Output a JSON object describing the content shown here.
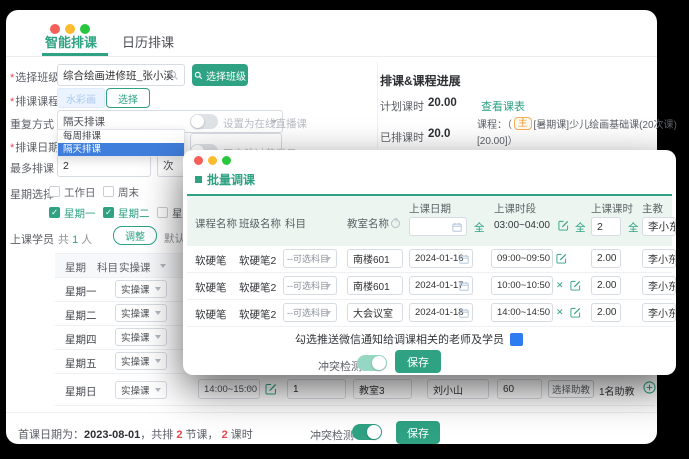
{
  "window": {
    "tabs": [
      {
        "label": "智能排课",
        "active": true
      },
      {
        "label": "日历排课",
        "active": false
      }
    ],
    "form": {
      "class": {
        "label": "选择班级",
        "value": "综合绘画进修班_张小溪",
        "button": "选择班级"
      },
      "course": {
        "label": "排课课程",
        "tag": "水彩画",
        "button": "选择"
      },
      "repeat": {
        "label": "重复方式",
        "value": "隔天排课",
        "options": [
          {
            "label": "每周排课",
            "active": false
          },
          {
            "label": "隔天排课",
            "active": true
          }
        ]
      },
      "date": {
        "label": "排课日期"
      },
      "max": {
        "label": "最多排课",
        "value": "2",
        "unit": "次"
      },
      "weektype": {
        "label": "星期选择",
        "options": [
          {
            "label": "工作日",
            "checked": false
          },
          {
            "label": "周末",
            "checked": false
          }
        ]
      },
      "weekdays": [
        {
          "label": "星期一",
          "checked": true
        },
        {
          "label": "星期二",
          "checked": true
        },
        {
          "label": "星期三",
          "checked": false
        }
      ],
      "students": {
        "label": "上课学员",
        "count_prefix": "共",
        "count": "1",
        "count_suffix": "人",
        "button": "调整",
        "hint": "默认为当前班级"
      },
      "toggles": [
        {
          "label": "设置为在线直播课",
          "on": false
        },
        {
          "label": "开启跳过节假日",
          "on": false
        }
      ]
    },
    "week_table": {
      "header": {
        "day": "星期",
        "subject": "科目",
        "subject_value": "实操课"
      },
      "rows": [
        {
          "day": "星期一",
          "value": "实操课",
          "sunday": false
        },
        {
          "day": "星期二",
          "value": "实操课",
          "sunday": false
        },
        {
          "day": "星期四",
          "value": "实操课",
          "sunday": false
        },
        {
          "day": "星期五",
          "value": "实操课",
          "sunday": false
        },
        {
          "day": "星期日",
          "value": "实操课",
          "sunday": true
        }
      ],
      "sunday": {
        "time": "14:00~15:00",
        "lessons": "1",
        "room": "教室3",
        "teacher": "刘小山",
        "minutes": "60",
        "assistant_button": "选择助教",
        "assistant_count": "1名助教"
      }
    },
    "progress": {
      "title": "排课&课程进展",
      "planned_label": "计划课时",
      "planned_value": "20.00",
      "view_link": "查看课表",
      "done_label": "已排课时",
      "done_value": "20.0",
      "course_prefix": "课程：（",
      "badge": "主",
      "course_name": "[暑期课]少儿绘画基础课(20次课)",
      "course_suffix": "[20.00]）"
    },
    "footer": {
      "prefix": "首课日期为：",
      "date": "2023-08-01",
      "seg1": "，共排 ",
      "n1": "2",
      "seg2": " 节课， ",
      "n2": "2",
      "seg3": " 课时",
      "conflict": "冲突检测",
      "save": "保存"
    }
  },
  "modal": {
    "title": "批量调课",
    "header": {
      "course": "课程名称",
      "clazz": "班级名称",
      "subject": "科目",
      "room": "教室名称",
      "date": "上课日期",
      "time": "上课时段",
      "hours": "上课课时",
      "teacher": "主教",
      "all": "全",
      "time_value": "03:00~04:00",
      "hours_value": "2",
      "teacher_value": "李小东"
    },
    "rows": [
      {
        "course": "软硬笔",
        "clazz": "软硬笔2",
        "subject": "--可选科目",
        "room": "南楼601",
        "date": "2024-01-16",
        "time": "09:00~09:50",
        "closable": false,
        "hours": "2.00",
        "teacher": "李小东"
      },
      {
        "course": "软硬笔",
        "clazz": "软硬笔2",
        "subject": "--可选科目",
        "room": "南楼601",
        "date": "2024-01-17",
        "time": "10:00~10:50",
        "closable": true,
        "hours": "2.00",
        "teacher": "李小东"
      },
      {
        "course": "软硬笔",
        "clazz": "软硬笔2",
        "subject": "--可选科目",
        "room": "大会议室",
        "date": "2024-01-18",
        "time": "14:00~14:50",
        "closable": true,
        "hours": "2.00",
        "teacher": "李小东"
      }
    ],
    "notify": "勾选推送微信通知给调课相关的老师及学员",
    "conflict": "冲突检测",
    "save": "保存"
  },
  "icons": {
    "search": "search-icon",
    "calendar": "calendar-icon",
    "edit": "edit-pencil-icon",
    "close": "close-icon",
    "plus": "plus-circle-icon",
    "question": "question-circle-icon",
    "caret": "chevron-down-icon"
  },
  "colors": {
    "teal": "#2ea283",
    "menu_active_blue": "#3f7edb",
    "checkbox_blue": "#2e7cf0",
    "red": "#e9474a",
    "badge_orange": "#ef9c2e",
    "tag_bg": "#eaf3fe",
    "tag_text": "#a9c8f0",
    "header_green": "#ecf5f0",
    "background": "#000000"
  }
}
